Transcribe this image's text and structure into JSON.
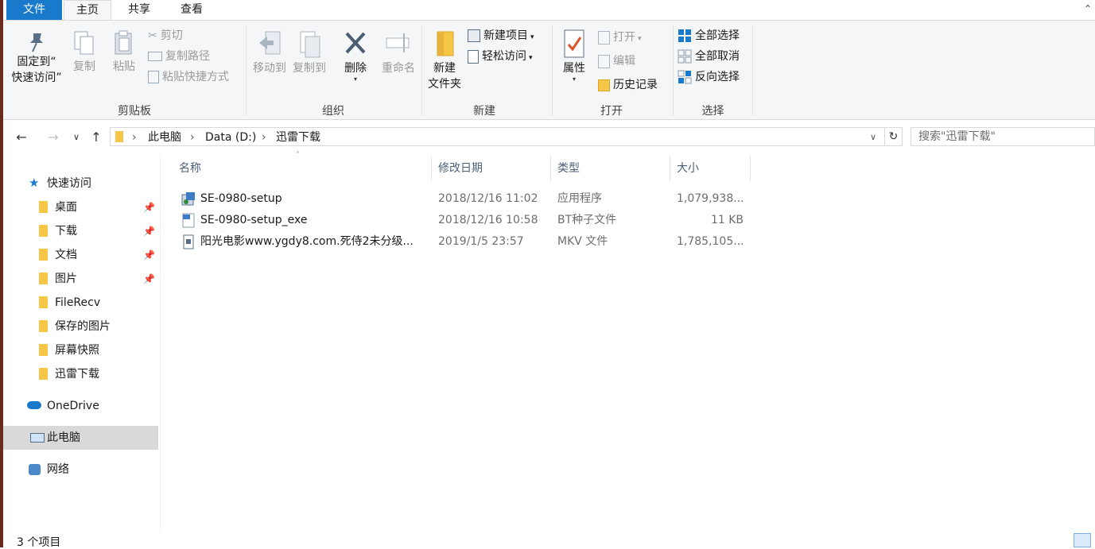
{
  "tabs": {
    "file": "文件",
    "home": "主页",
    "share": "共享",
    "view": "查看"
  },
  "ribbon": {
    "clipboard": {
      "label": "剪贴板",
      "pin": "固定到“\n快速访问”",
      "copy": "复制",
      "paste": "粘贴",
      "cut": "剪切",
      "copy_path": "复制路径",
      "paste_shortcut": "粘贴快捷方式"
    },
    "organize": {
      "label": "组织",
      "move_to": "移动到",
      "copy_to": "复制到",
      "delete": "删除",
      "rename": "重命名"
    },
    "new": {
      "label": "新建",
      "new_folder": "新建\n文件夹",
      "new_item": "新建项目",
      "easy_access": "轻松访问"
    },
    "open": {
      "label": "打开",
      "properties": "属性",
      "open": "打开",
      "edit": "编辑",
      "history": "历史记录"
    },
    "select": {
      "label": "选择",
      "select_all": "全部选择",
      "select_none": "全部取消",
      "invert": "反向选择"
    }
  },
  "address": {
    "crumbs": [
      "此电脑",
      "Data (D:)",
      "迅雷下载"
    ],
    "search_placeholder": "搜索\"迅雷下载\""
  },
  "nav": {
    "quick_access": "快速访问",
    "items": [
      "桌面",
      "下载",
      "文档",
      "图片",
      "FileRecv",
      "保存的图片",
      "屏幕快照",
      "迅雷下载"
    ],
    "onedrive": "OneDrive",
    "this_pc": "此电脑",
    "network": "网络"
  },
  "columns": {
    "name": "名称",
    "date": "修改日期",
    "type": "类型",
    "size": "大小"
  },
  "files": [
    {
      "name": "SE-0980-setup",
      "date": "2018/12/16 11:02",
      "type": "应用程序",
      "size": "1,079,938..."
    },
    {
      "name": "SE-0980-setup_exe",
      "date": "2018/12/16 10:58",
      "type": "BT种子文件",
      "size": "11 KB"
    },
    {
      "name": "阳光电影www.ygdy8.com.死侍2未分级...",
      "date": "2019/1/5 23:57",
      "type": "MKV 文件",
      "size": "1,785,105..."
    }
  ],
  "status": {
    "count": "3 个项目"
  },
  "colors": {
    "accent": "#1979ca",
    "folder": "#f6c646",
    "selected": "#d9d9d9"
  }
}
